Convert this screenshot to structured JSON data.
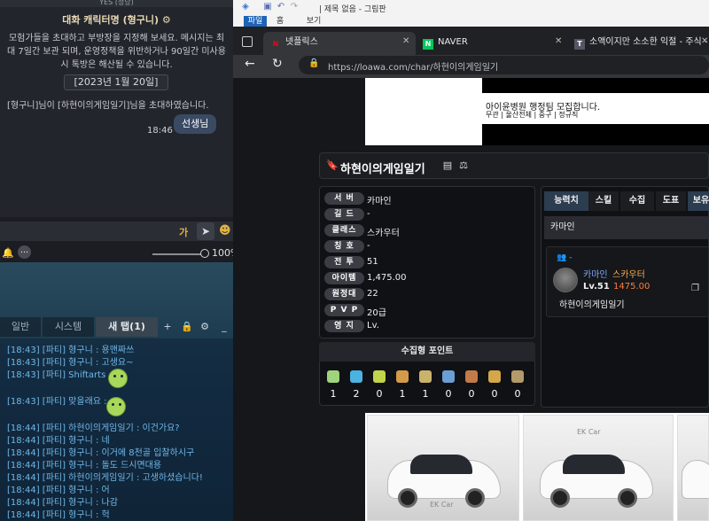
{
  "chat": {
    "top_strip": "YES (정당)",
    "title": "대화 캐릭터명 (형구니)",
    "notice": "모험가들을 초대하고 부방장을 지정해 보세요. 메시지는 최대 7일간 보관 되며, 운영정책을 위반하거나 90일간 미사용 시 톡방은 해산될 수 있습니다.",
    "date": "[2023년 1월 20일]",
    "system_message": "[형구니]님이 [하현이의게임일기]님을 초대하였습니다.",
    "bubble_time": "18:46",
    "bubble_text": "선생님",
    "input_char": "가",
    "volume": "100%"
  },
  "game_chat": {
    "tabs": [
      {
        "label": "일반"
      },
      {
        "label": "시스템"
      },
      {
        "label": "새 탭(1)"
      }
    ],
    "messages": [
      "[18:43] [파티] 형구니 : 용맨짜쓰",
      "[18:43] [파티] 형구니 : 고생요~",
      "[18:43] [파티] Shiftarts :",
      "[18:43] [파티] 맞을래요 :",
      "[18:44] [파티] 하현이의게임일기 : 이건가요?",
      "[18:44] [파티] 형구니 : 네",
      "[18:44] [파티] 형구니 : 이거에 8천골 입찰하시구",
      "[18:44] [파티] 형구니 : 돌도 드시면대용",
      "[18:44] [파티] 하현이의게임일기 : 고생하셨습니다!",
      "[18:44] [파티] 형구니 : 어",
      "[18:44] [파티] 형구니 : 나감",
      "[18:44] [파티] 형구니 : 헉"
    ]
  },
  "paint": {
    "title": "| 제목 없음 - 그림판",
    "tabs": [
      "파일",
      "홈",
      "보기"
    ]
  },
  "browser": {
    "tabs": [
      {
        "label": "넷플릭스",
        "favicon": "N"
      },
      {
        "label": "NAVER",
        "favicon": "N"
      },
      {
        "label": "소액이지만 소소한 익절 - 주식 -",
        "favicon": "T"
      }
    ],
    "url": "https://loawa.com/char/하현이의게임일기"
  },
  "banner": {
    "line1": "아이윤병원 행정팀 모집합니다.",
    "line2": "무관 | 울산전체 | 중구 | 정규직"
  },
  "character": {
    "name": "하현이의게임일기",
    "info": [
      {
        "label": "서 버",
        "value": "카마인"
      },
      {
        "label": "길 드",
        "value": "-"
      },
      {
        "label": "클래스",
        "value": "스카우터"
      },
      {
        "label": "칭 호",
        "value": "-"
      },
      {
        "label": "전 투",
        "value": "51"
      },
      {
        "label": "아이템",
        "value": "1,475.00"
      },
      {
        "label": "원정대",
        "value": "22"
      },
      {
        "label": "P V P",
        "value": "20급"
      },
      {
        "label": "영 지",
        "value": "Lv."
      }
    ],
    "collect_title": "수집형 포인트",
    "collect_values": [
      "1",
      "2",
      "0",
      "1",
      "1",
      "0",
      "0",
      "0",
      "0"
    ],
    "collect_colors": [
      "#9fd47a",
      "#4bb3e0",
      "#c2d44a",
      "#d49a4a",
      "#c9b36a",
      "#6a9ed4",
      "#c27a4a",
      "#d4a74a",
      "#b39a6a"
    ],
    "right_tabs": [
      "능력치",
      "스킬",
      "수집",
      "도표",
      "보유"
    ],
    "subbar": "카마인",
    "card": {
      "group": "-",
      "server": "카마인",
      "class": "스카우터",
      "level": "Lv.51",
      "item_level": "1475.00",
      "name": "하현이의게임일기"
    }
  },
  "ads": {
    "tag": "EK Car"
  }
}
